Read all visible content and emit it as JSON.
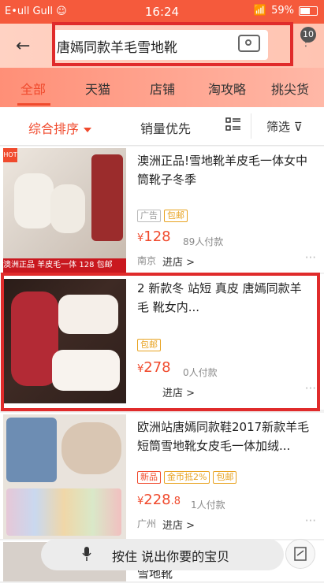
{
  "status_bar": {
    "left": "E•ull Gull ☺",
    "time": "16:24",
    "battery": "59%"
  },
  "search": {
    "query": "唐嫣同款羊毛雪地靴",
    "badge_count": "10"
  },
  "tabs": [
    "全部",
    "天猫",
    "店铺",
    "淘攻略",
    "挑尖货"
  ],
  "sort": {
    "comprehensive": "综合排序",
    "sales": "销量优先",
    "filter": "筛选"
  },
  "products": [
    {
      "title": "澳洲正品!雪地靴羊皮毛一体女中筒靴子冬季",
      "tags": [
        "广告",
        "包邮"
      ],
      "price": "128",
      "paid": "89人付款",
      "location": "南京",
      "store": "进店 >",
      "thumb_text": "澳洲正品 羊皮毛一体 128 包邮"
    },
    {
      "title": "2 新款冬 站短 真皮 唐嫣同款羊毛 靴女内...",
      "tags": [
        "包邮"
      ],
      "price": "278",
      "paid": "0人付款",
      "location": "",
      "store": "进店 >"
    },
    {
      "title": "欧洲站唐嫣同款鞋2017新款羊毛短筒雪地靴女皮毛一体加绒...",
      "tags": [
        "新品",
        "金币抵2%",
        "包邮"
      ],
      "price": "228",
      "price_decimal": ".8",
      "paid": "1人付款",
      "location": "广州",
      "store": "进店 >"
    }
  ],
  "bottom": {
    "voice": "按住 说出你要的宝贝",
    "partial_title": "雪地靴"
  },
  "colors": {
    "accent": "#f04a2d",
    "status_bar": "#f55a3c",
    "highlight_frame": "#e02b2b"
  }
}
